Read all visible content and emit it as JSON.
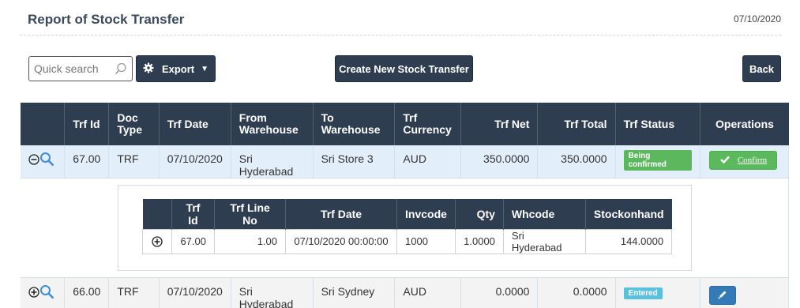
{
  "header": {
    "title": "Report of Stock Transfer",
    "date": "07/10/2020"
  },
  "toolbar": {
    "search_placeholder": "Quick search",
    "export_label": "Export",
    "create_label": "Create New Stock Transfer",
    "back_label": "Back"
  },
  "table": {
    "columns": [
      "",
      "Trf Id",
      "Doc Type",
      "Trf Date",
      "From Warehouse",
      "To Warehouse",
      "Trf Currency",
      "Trf Net",
      "Trf Total",
      "Trf Status",
      "Operations"
    ],
    "rows": [
      {
        "trf_id": "67.00",
        "doc_type": "TRF",
        "trf_date": "07/10/2020",
        "from": "Sri Hyderabad",
        "to": "Sri Store 3",
        "currency": "AUD",
        "net": "350.0000",
        "total": "350.0000",
        "status": "Being confirmed",
        "operation": "Confirm",
        "expanded": true
      },
      {
        "trf_id": "66.00",
        "doc_type": "TRF",
        "trf_date": "07/10/2020",
        "from": "Sri Hyderabad",
        "to": "Sri Sydney",
        "currency": "AUD",
        "net": "0.0000",
        "total": "0.0000",
        "status": "Entered",
        "operation": "",
        "expanded": false
      }
    ]
  },
  "detail": {
    "columns": [
      "",
      "Trf Id",
      "Trf Line No",
      "Trf Date",
      "Invcode",
      "Qty",
      "Whcode",
      "Stockonhand"
    ],
    "rows": [
      {
        "trf_id": "67.00",
        "line_no": "1.00",
        "trf_date": "07/10/2020 00:00:00",
        "invcode": "1000",
        "qty": "1.0000",
        "whcode": "Sri Hyderabad",
        "stockonhand": "144.0000"
      }
    ]
  },
  "colors": {
    "header_bg": "#2e3d4f",
    "highlight_row": "#e3eefb",
    "success": "#5cb85c",
    "info": "#5bc0de",
    "primary": "#337ab7"
  },
  "icons": [
    "search-icon",
    "gear-icon",
    "caret-down-icon",
    "collapse-icon",
    "expand-icon",
    "zoom-icon",
    "check-icon",
    "pencil-icon"
  ]
}
